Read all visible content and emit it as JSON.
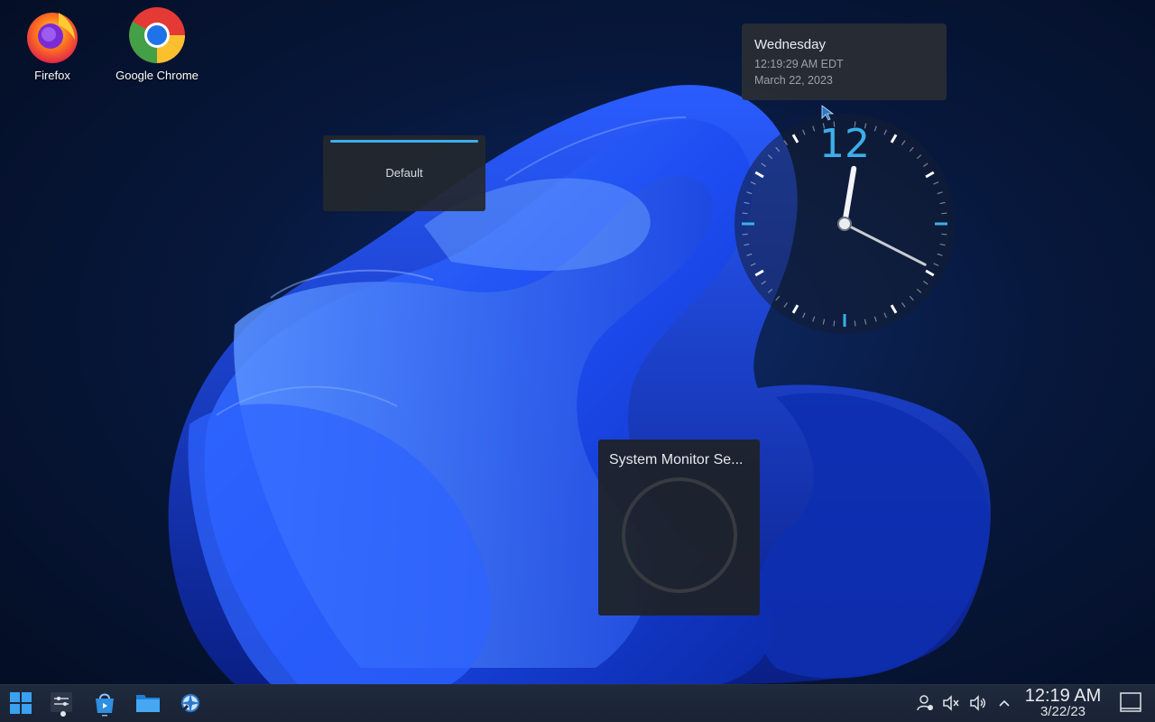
{
  "desktop": {
    "icons": [
      {
        "label": "Firefox",
        "icon": "firefox-icon"
      },
      {
        "label": "Google Chrome",
        "icon": "chrome-icon"
      }
    ]
  },
  "date_tooltip": {
    "day": "Wednesday",
    "time": "12:19:29 AM EDT",
    "date": "March 22, 2023"
  },
  "osd": {
    "label": "Default",
    "accent": "#3daee9"
  },
  "analog_clock": {
    "numeral": "12",
    "hour": 12,
    "minute": 19,
    "second": 29
  },
  "system_monitor": {
    "title": "System Monitor Se..."
  },
  "taskbar": {
    "launchers": [
      {
        "name": "start-menu-icon"
      },
      {
        "name": "system-settings-icon"
      },
      {
        "name": "discover-store-icon"
      },
      {
        "name": "file-manager-icon"
      },
      {
        "name": "krunner-icon"
      }
    ],
    "tray": [
      "user-icon",
      "muted-icon",
      "volume-icon",
      "expand-tray-icon"
    ],
    "time": "12:19 AM",
    "date": "3/22/23"
  },
  "colors": {
    "accent": "#3daee9",
    "wallpaper_blue": "#1a4bff",
    "panel": "#1f2a3d"
  }
}
